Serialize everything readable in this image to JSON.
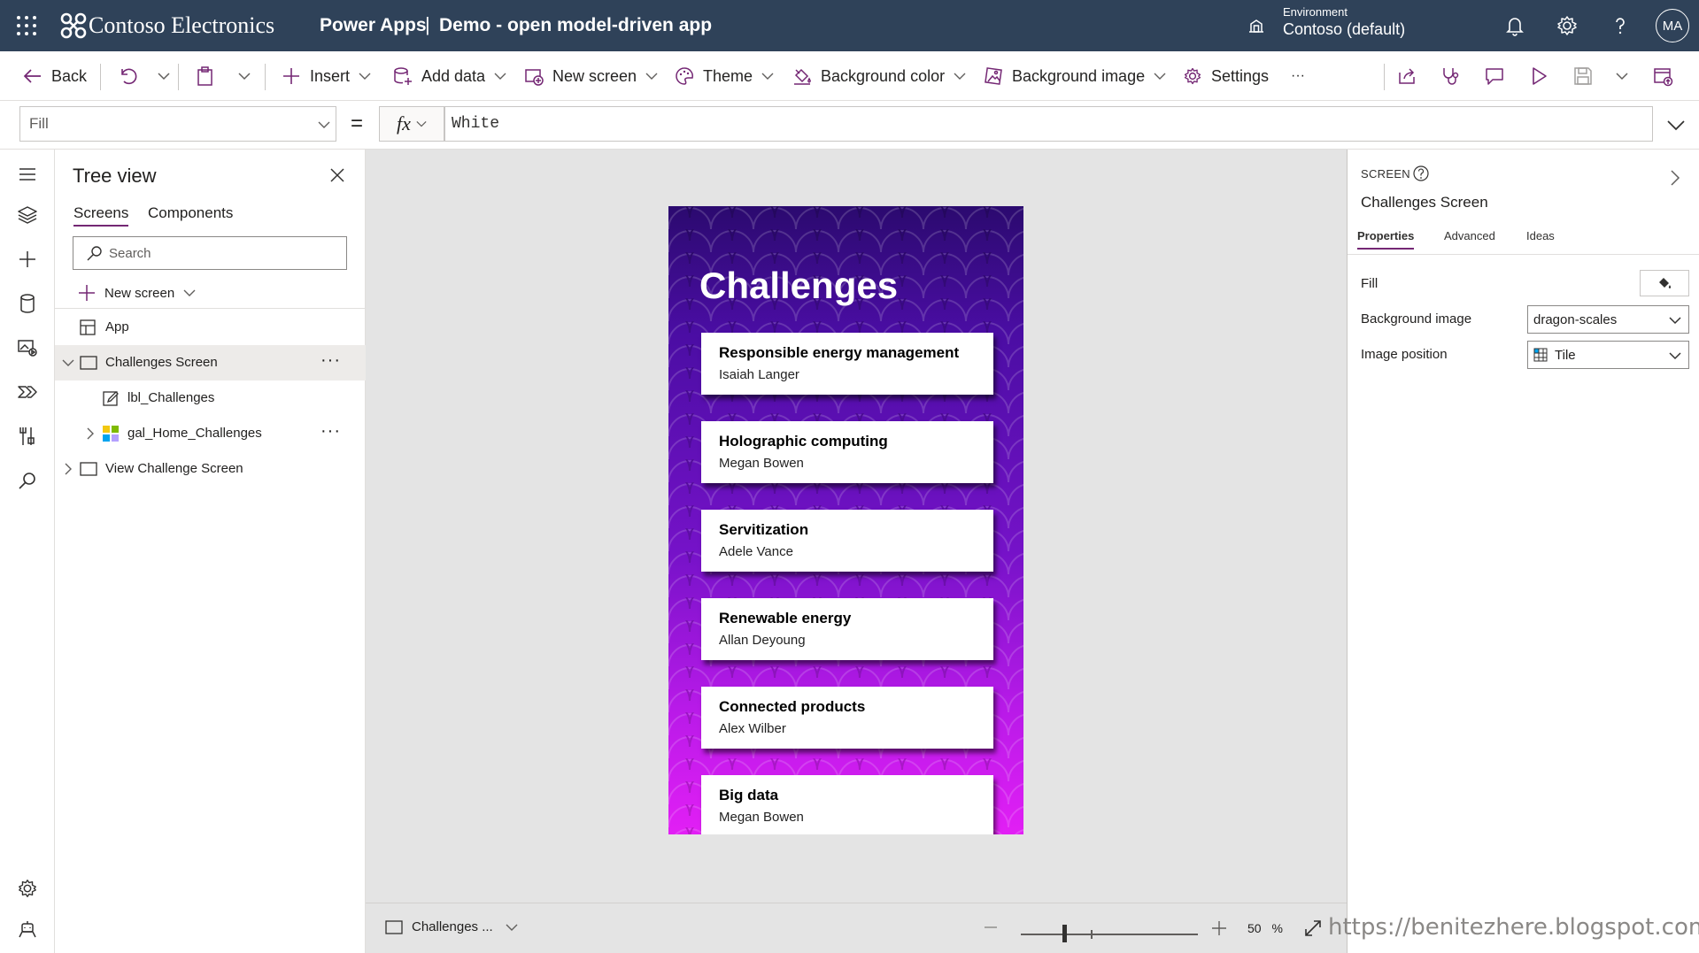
{
  "header": {
    "brand": "Contoso Electronics",
    "app_name": "Power Apps",
    "separator": "|",
    "app_description": "Demo - open model-driven app",
    "environment_label": "Environment",
    "environment_value": "Contoso (default)",
    "avatar_initials": "MA"
  },
  "commands": {
    "back": "Back",
    "insert": "Insert",
    "add_data": "Add data",
    "new_screen": "New screen",
    "theme": "Theme",
    "background_color": "Background color",
    "background_image": "Background image",
    "settings": "Settings",
    "more": "···"
  },
  "formula_bar": {
    "property": "Fill",
    "equals": "=",
    "fx": "fx",
    "formula": "White"
  },
  "tree_view": {
    "title": "Tree view",
    "tabs": [
      "Screens",
      "Components"
    ],
    "search_placeholder": "Search",
    "new_screen": "New screen",
    "nodes": {
      "app": "App",
      "challenges_screen": "Challenges Screen",
      "lbl_challenges": "lbl_Challenges",
      "gal_home_challenges": "gal_Home_Challenges",
      "view_challenge_screen": "View Challenge Screen"
    },
    "more": "···"
  },
  "canvas": {
    "screen_title": "Challenges",
    "cards": [
      {
        "title": "Responsible energy management",
        "person": "Isaiah Langer"
      },
      {
        "title": "Holographic computing",
        "person": "Megan Bowen"
      },
      {
        "title": "Servitization",
        "person": "Adele Vance"
      },
      {
        "title": "Renewable energy",
        "person": "Allan Deyoung"
      },
      {
        "title": "Connected products",
        "person": "Alex Wilber"
      },
      {
        "title": "Big data",
        "person": "Megan Bowen"
      }
    ]
  },
  "bottom_bar": {
    "screen_selector": "Challenges ...",
    "zoom_value": "50",
    "zoom_unit": "%"
  },
  "properties": {
    "kind": "SCREEN",
    "name": "Challenges Screen",
    "tabs": [
      "Properties",
      "Advanced",
      "Ideas"
    ],
    "fill_label": "Fill",
    "background_image_label": "Background image",
    "background_image_value": "dragon-scales",
    "image_position_label": "Image position",
    "image_position_value": "Tile"
  },
  "watermark": "https://benitezhere.blogspot.com",
  "colors": {
    "header_bg": "#2f4259",
    "accent": "#742774",
    "canvas_bg": "#e4e4e4",
    "screen_top": "#2b0a6f",
    "screen_bottom": "#e21ff5"
  }
}
